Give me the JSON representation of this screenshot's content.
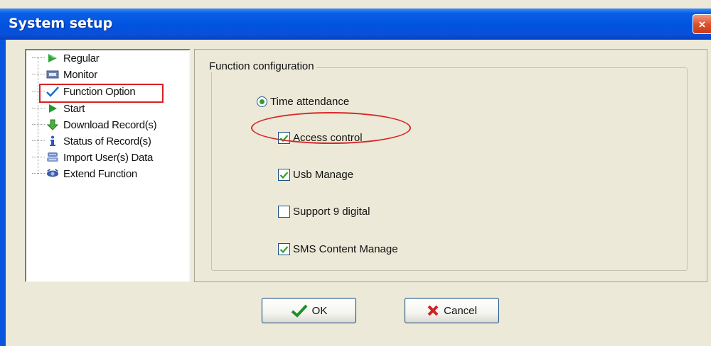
{
  "window": {
    "title": "System setup",
    "close_glyph": "×"
  },
  "tree": {
    "items": [
      {
        "label": "Regular",
        "icon": "green-arrow-icon"
      },
      {
        "label": "Monitor",
        "icon": "monitor-icon"
      },
      {
        "label": "Function Option",
        "icon": "checkmark-icon",
        "selected": true
      },
      {
        "label": "Start",
        "icon": "play-icon"
      },
      {
        "label": "Download Record(s)",
        "icon": "download-arrow-icon"
      },
      {
        "label": "Status of Record(s)",
        "icon": "info-icon"
      },
      {
        "label": "Import User(s) Data",
        "icon": "import-users-icon"
      },
      {
        "label": "Extend Function",
        "icon": "extend-icon"
      }
    ]
  },
  "config": {
    "group_label": "Function configuration",
    "radio": {
      "label": "Time attendance",
      "checked": true
    },
    "checkboxes": [
      {
        "label": "Access control",
        "checked": true
      },
      {
        "label": "Usb Manage",
        "checked": true
      },
      {
        "label": "Support 9 digital",
        "checked": false
      },
      {
        "label": "SMS Content Manage",
        "checked": true
      }
    ]
  },
  "buttons": {
    "ok_label": "OK",
    "cancel_label": "Cancel"
  },
  "colors": {
    "title_bar": "#0053e0",
    "highlight": "#d82020",
    "check_green": "#2ea02e"
  }
}
